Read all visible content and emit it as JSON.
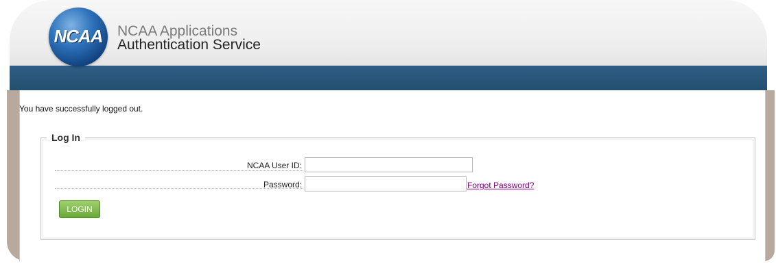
{
  "header": {
    "logo_text": "NCAA",
    "title_line1": "NCAA Applications",
    "title_line2": "Authentication Service"
  },
  "message": "You have successfully logged out.",
  "login_form": {
    "legend": "Log In",
    "user_id_label": "NCAA User ID:",
    "user_id_value": "",
    "password_label": "Password:",
    "password_value": "",
    "forgot_password": "Forgot Password?",
    "login_button": "LOGIN"
  },
  "colors": {
    "navbar": "#2b5679",
    "side_frame": "#b7a99d",
    "button_green": "#7ab648",
    "link_visited": "#800080"
  }
}
